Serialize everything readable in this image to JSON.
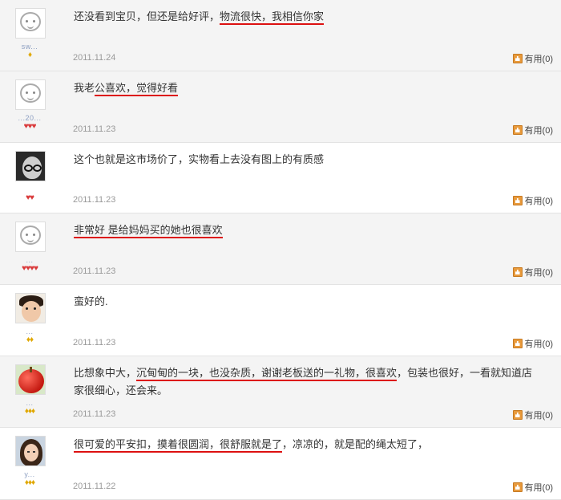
{
  "reviews": [
    {
      "segments": [
        {
          "text": "还没看到宝贝，但还是给好评，",
          "u": false
        },
        {
          "text": "物流很快，我相信你家",
          "u": true
        }
      ],
      "date": "2011.11.24",
      "username": "sw...",
      "avatar": "default-face",
      "rank": {
        "kind": "diamond",
        "count": 1
      },
      "useful_label": "有用(0)"
    },
    {
      "segments": [
        {
          "text": "我老",
          "u": false
        },
        {
          "text": "公喜欢，觉得好看",
          "u": true
        }
      ],
      "date": "2011.11.23",
      "username": "...20...",
      "avatar": "default-face",
      "rank": {
        "kind": "heart",
        "count": 3
      },
      "useful_label": "有用(0)"
    },
    {
      "segments": [
        {
          "text": "这个也就是这市场价了，实物看上去没有图上的有质感",
          "u": false
        }
      ],
      "date": "2011.11.23",
      "username": "",
      "avatar": "photo-girl-glasses",
      "rank": {
        "kind": "heart",
        "count": 2
      },
      "useful_label": "有用(0)"
    },
    {
      "segments": [
        {
          "text": "非常好 是给妈妈买的她也很喜欢",
          "u": true
        }
      ],
      "date": "2011.11.23",
      "username": "...",
      "avatar": "default-face",
      "rank": {
        "kind": "heart",
        "count": 4
      },
      "useful_label": "有用(0)"
    },
    {
      "segments": [
        {
          "text": "蛮好的.",
          "u": false
        }
      ],
      "date": "2011.11.23",
      "username": "...",
      "avatar": "photo-baby",
      "rank": {
        "kind": "diamond",
        "count": 2
      },
      "useful_label": "有用(0)"
    },
    {
      "segments": [
        {
          "text": "比想象中大，",
          "u": false
        },
        {
          "text": "沉甸甸的一块，也没杂质，谢谢老板送的一礼物，很喜欢",
          "u": true
        },
        {
          "text": "，包装也很好，一看就知道店家很细心，还会来。",
          "u": false
        }
      ],
      "date": "2011.11.23",
      "username": "...",
      "avatar": "photo-apple",
      "rank": {
        "kind": "diamond",
        "count": 3
      },
      "useful_label": "有用(0)"
    },
    {
      "segments": [
        {
          "text": "很可爱的平安扣，摸着很圆润，很舒服就是了",
          "u": true
        },
        {
          "text": "，凉凉的，就是配的绳太短了，",
          "u": false
        }
      ],
      "date": "2011.11.22",
      "username": "y...",
      "avatar": "photo-woman",
      "rank": {
        "kind": "diamond",
        "count": 3
      },
      "useful_label": "有用(0)"
    }
  ],
  "colors": {
    "underline": "#dd1111",
    "date": "#999999",
    "heart": "#d9393a",
    "diamond": "#e0a800"
  },
  "icons": {
    "useful": "thumb-up-icon",
    "heart": "heart-rank-icon",
    "diamond": "diamond-rank-icon"
  }
}
